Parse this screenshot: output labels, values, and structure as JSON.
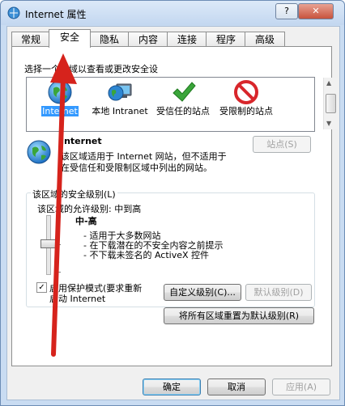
{
  "window": {
    "title": "Internet 属性",
    "help_label": "?",
    "close_label": "✕"
  },
  "tabs": [
    {
      "label": "常规"
    },
    {
      "label": "安全"
    },
    {
      "label": "隐私"
    },
    {
      "label": "内容"
    },
    {
      "label": "连接"
    },
    {
      "label": "程序"
    },
    {
      "label": "高级"
    }
  ],
  "active_tab": "安全",
  "security": {
    "zone_prompt": "选择一个区域以查看或更改安全设",
    "zones": [
      {
        "label": "Internet",
        "icon": "globe-icon"
      },
      {
        "label": "本地 Intranet",
        "icon": "local-intranet-icon"
      },
      {
        "label": "受信任的站点",
        "icon": "checkmark-icon"
      },
      {
        "label": "受限制的站点",
        "icon": "restricted-icon"
      }
    ],
    "selected_zone_name": "Internet",
    "selected_zone_description_line1": "该区域适用于 Internet 网站，但不适用于",
    "selected_zone_description_line2": "在受信任和受限制区域中列出的网站。",
    "sites_button": "站点(S)",
    "level_group_title": "该区域的安全级别(L)",
    "allowed_levels": "该区域的允许级别: 中到高",
    "level_name": "中-高",
    "level_bullets": [
      "- 适用于大多数网站",
      "- 在下载潜在的不安全内容之前提示",
      "- 不下载未签名的 ActiveX 控件"
    ],
    "slider_level_fraction": 0.5,
    "protected_mode_line1": "启用保护模式(要求重新",
    "protected_mode_line2": "启动 Internet",
    "protected_mode_checked": true,
    "check_mark": "✓",
    "custom_level_button": "自定义级别(C)...",
    "default_level_button": "默认级别(D)",
    "reset_all_button": "将所有区域重置为默认级别(R)"
  },
  "footer": {
    "ok": "确定",
    "cancel": "取消",
    "apply": "应用(A)"
  },
  "colors": {
    "arrow": "#d6231c",
    "selection": "#3399ff",
    "restricted": "#d8262b",
    "trusted": "#3aa53a"
  }
}
